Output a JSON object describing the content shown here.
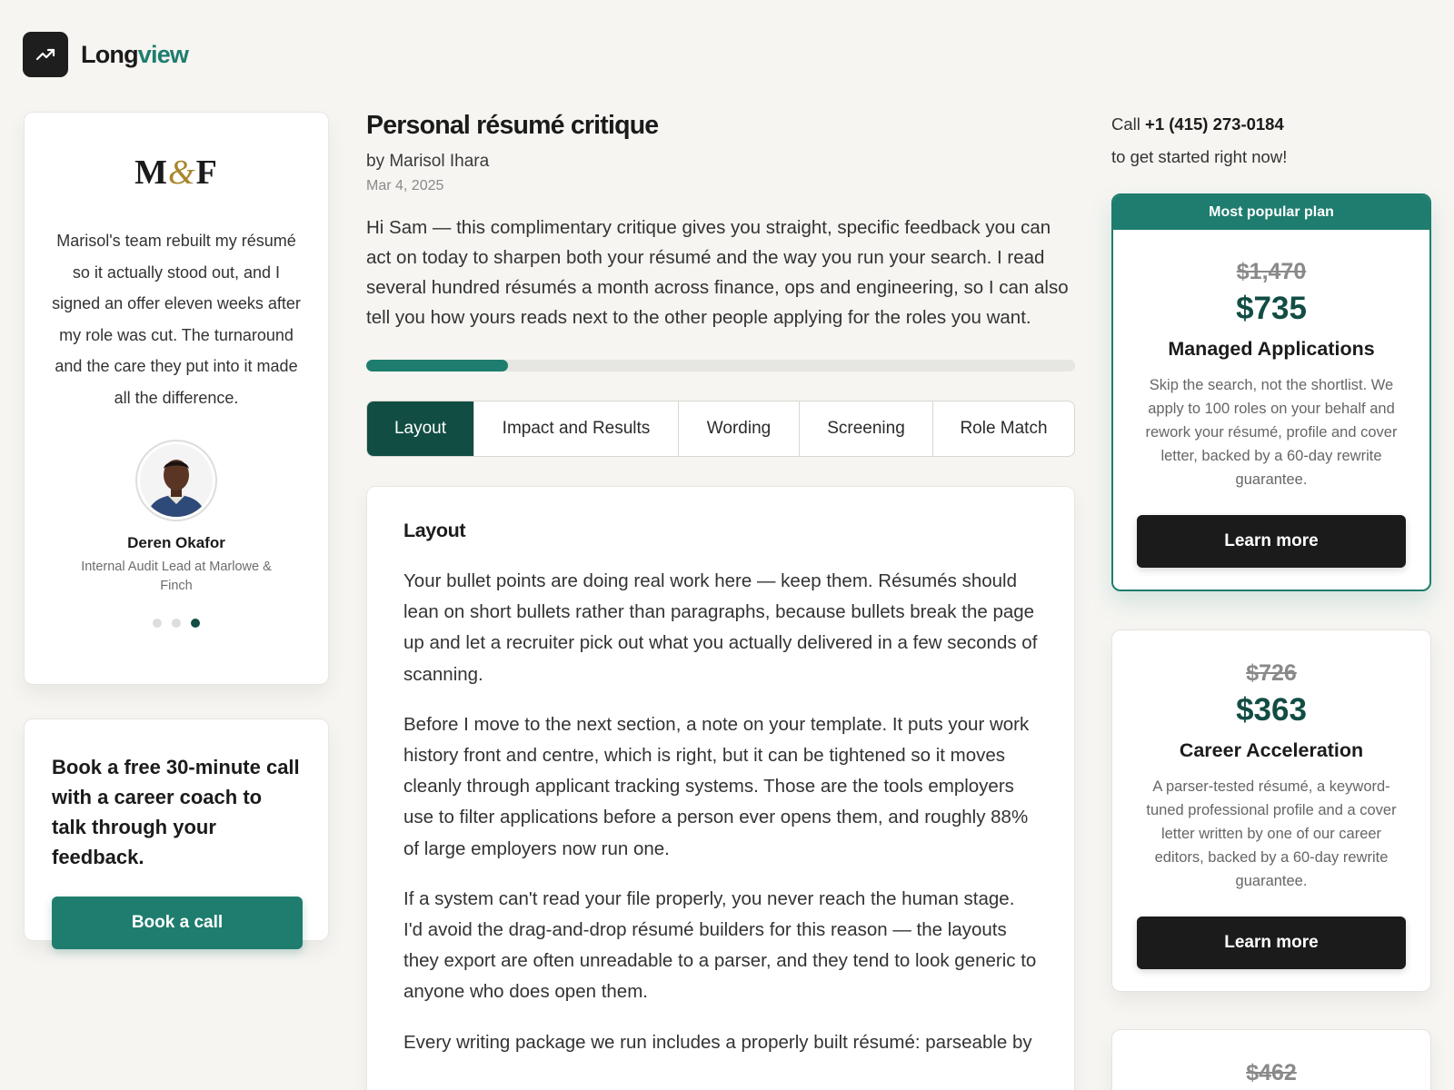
{
  "header": {
    "logo_icon": "trending-up-icon",
    "brand_part1": "Long",
    "brand_part2": "view",
    "accent_color": "#1e7d6e"
  },
  "testimonial": {
    "company_logo_m": "M",
    "company_logo_amp": "&",
    "company_logo_f": "F",
    "quote": "Marisol's team rebuilt my résumé so it actually stood out, and I signed an offer eleven weeks after my role was cut. The turnaround and the care they put into it made all the difference.",
    "name": "Deren Okafor",
    "role": "Internal Audit Lead at Marlowe & Finch",
    "dots_count": 3,
    "active_dot": 3
  },
  "booking": {
    "title": "Book a free 30-minute call with a career coach to talk through your feedback.",
    "button_label": "Book a call"
  },
  "article": {
    "title": "Personal résumé critique",
    "byline": "by Marisol Ihara",
    "date": "Mar 4, 2025",
    "intro": "Hi Sam — this complimentary critique gives you straight, specific feedback you can act on today to sharpen both your résumé and the way you run your search. I read several hundred résumés a month across finance, ops and engineering, so I can also tell you how yours reads next to the other people applying for the roles you want.",
    "progress_fraction": 0.2
  },
  "tabs": [
    {
      "label": "Layout",
      "active": true
    },
    {
      "label": "Impact and Results",
      "active": false
    },
    {
      "label": "Wording",
      "active": false
    },
    {
      "label": "Screening",
      "active": false
    },
    {
      "label": "Role Match",
      "active": false
    }
  ],
  "section": {
    "title": "Layout",
    "paragraphs": [
      "Your bullet points are doing real work here — keep them. Résumés should lean on short bullets rather than paragraphs, because bullets break the page up and let a recruiter pick out what you actually delivered in a few seconds of scanning.",
      "Before I move to the next section, a note on your template. It puts your work history front and centre, which is right, but it can be tightened so it moves cleanly through applicant tracking systems. Those are the tools employers use to filter applications before a person ever opens them, and roughly 88% of large employers now run one.",
      "If a system can't read your file properly, you never reach the human stage. I'd avoid the drag-and-drop résumé builders for this reason — the layouts they export are often unreadable to a parser, and they tend to look generic to anyone who does open them.",
      "Every writing package we run includes a properly built résumé: parseable by"
    ]
  },
  "contact": {
    "call_prefix": "Call",
    "phone": "+1 (415) 273-0184",
    "call_suffix": "to get started right now!"
  },
  "plans": [
    {
      "banner": "Most popular plan",
      "old_price": "$1,470",
      "price": "$735",
      "name": "Managed Applications",
      "description": "Skip the search, not the shortlist. We apply to 100 roles on your behalf and rework your résumé, profile and cover letter, backed by a 60-day rewrite guarantee.",
      "button_label": "Learn more"
    },
    {
      "old_price": "$726",
      "price": "$363",
      "name": "Career Acceleration",
      "description": "A parser-tested résumé, a keyword-tuned professional profile and a cover letter written by one of our career editors, backed by a 60-day rewrite guarantee.",
      "button_label": "Learn more"
    },
    {
      "old_price": "$462"
    }
  ]
}
